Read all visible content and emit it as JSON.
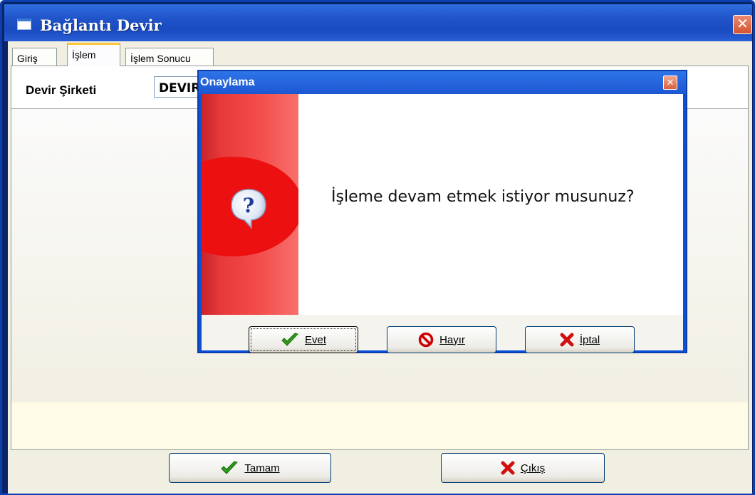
{
  "main_window": {
    "title": "Bağlantı Devir",
    "close_glyph": "✕",
    "tabs": [
      {
        "label": "Giriş"
      },
      {
        "label": "İşlem"
      },
      {
        "label": "İşlem Sonucu"
      }
    ],
    "active_tab": "İşlem",
    "form": {
      "devir_sirketi_label": "Devir Şirketi",
      "devir_sirketi_value": "DEVIR"
    },
    "buttons": {
      "ok": {
        "label": "Tamam",
        "icon": "check-icon"
      },
      "exit": {
        "label": "Çıkış",
        "icon": "x-icon"
      }
    }
  },
  "dialog": {
    "title": "Onaylama",
    "close_glyph": "✕",
    "message": "İşleme devam etmek istiyor musunuz?",
    "icon": "question-icon",
    "buttons": {
      "yes": {
        "label": "Evet",
        "icon": "check-icon"
      },
      "no": {
        "label": "Hayır",
        "icon": "no-entry-icon"
      },
      "cancel": {
        "label": "İptal",
        "icon": "x-icon"
      }
    }
  },
  "colors": {
    "titlebar": "#1f53c7",
    "dialog_accent": "#ec1010",
    "check_green": "#2e9a1a",
    "x_red": "#d01010"
  }
}
